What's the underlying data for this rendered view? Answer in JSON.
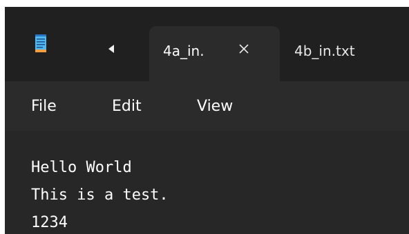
{
  "tabs": [
    {
      "label": "4a_in.",
      "active": true
    },
    {
      "label": "4b_in.txt",
      "active": false
    }
  ],
  "menu": {
    "file": "File",
    "edit": "Edit",
    "view": "View"
  },
  "editor": {
    "lines": [
      "Hello World",
      "This is a test.",
      "1234"
    ]
  },
  "icons": {
    "app": "notepad-icon",
    "scroll": "scroll-tabs-left-icon",
    "close": "close-icon"
  },
  "colors": {
    "titlebar": "#202020",
    "surface": "#2b2b2b",
    "editor_bg": "#272727",
    "text": "#ffffff",
    "notepad_blue": "#4fb8f0",
    "notepad_orange": "#f2a03d"
  }
}
